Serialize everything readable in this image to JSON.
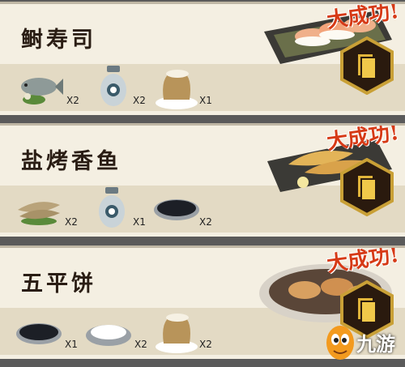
{
  "recipes": [
    {
      "name": "鲥寿司",
      "badge": "大成功!",
      "ingredients": [
        {
          "icon": "fish-icon",
          "qty": "X2"
        },
        {
          "icon": "salt-jar-icon",
          "qty": "X2"
        },
        {
          "icon": "rice-sack-icon",
          "qty": "X1"
        }
      ]
    },
    {
      "name": "盐烤香鱼",
      "badge": "大成功!",
      "ingredients": [
        {
          "icon": "sweetfish-icon",
          "qty": "X2"
        },
        {
          "icon": "salt-jar-icon",
          "qty": "X1"
        },
        {
          "icon": "seaweed-bowl-icon",
          "qty": "X2"
        }
      ]
    },
    {
      "name": "五平饼",
      "badge": "大成功!",
      "ingredients": [
        {
          "icon": "seaweed-bowl-icon",
          "qty": "X1"
        },
        {
          "icon": "flour-plate-icon",
          "qty": "X2"
        },
        {
          "icon": "rice-sack-icon",
          "qty": "X2"
        }
      ]
    }
  ],
  "watermark": {
    "brand": "九游"
  },
  "colors": {
    "badge": "#d63a16",
    "hex_button": "#2a1a0e",
    "hex_border": "#c9a036"
  }
}
